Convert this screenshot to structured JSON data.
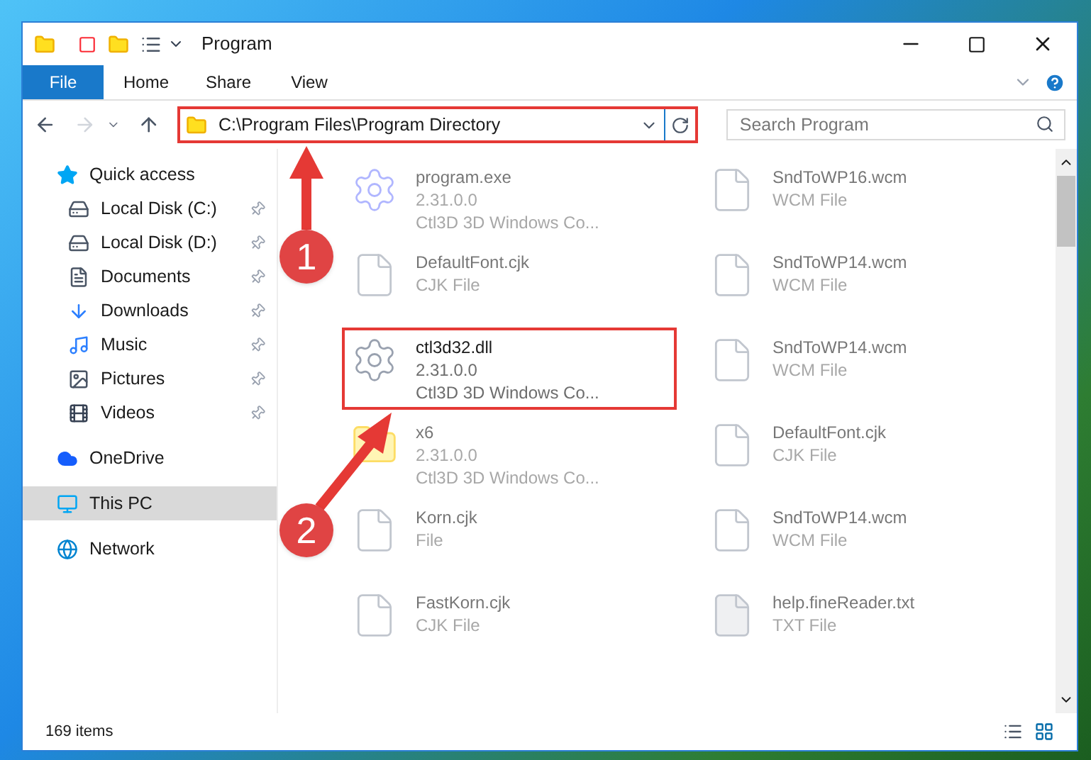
{
  "window": {
    "title": "Program"
  },
  "ribbon_tabs": [
    {
      "label": "File",
      "selected": true
    },
    {
      "label": "Home",
      "selected": false
    },
    {
      "label": "Share",
      "selected": false
    },
    {
      "label": "View",
      "selected": false
    }
  ],
  "address": {
    "path": "C:\\Program Files\\Program Directory",
    "highlighted": true
  },
  "search": {
    "placeholder": "Search Program"
  },
  "sidebar": [
    {
      "label": "Quick access",
      "kind": "star",
      "selected": false,
      "children": [
        {
          "label": "Local Disk (C:)",
          "kind": "drive",
          "pinned": true,
          "selected": false
        },
        {
          "label": "Local Disk (D:)",
          "kind": "drive",
          "pinned": true,
          "selected": false
        },
        {
          "label": "Documents",
          "kind": "document",
          "pinned": true,
          "selected": false
        },
        {
          "label": "Downloads",
          "kind": "download",
          "pinned": true,
          "selected": false
        },
        {
          "label": "Music",
          "kind": "music",
          "pinned": true,
          "selected": false
        },
        {
          "label": "Pictures",
          "kind": "picture",
          "pinned": true,
          "selected": false
        },
        {
          "label": "Videos",
          "kind": "video",
          "pinned": true,
          "selected": false
        }
      ]
    },
    {
      "label": "OneDrive",
      "kind": "cloud",
      "selected": false
    },
    {
      "label": "This PC",
      "kind": "pc",
      "selected": true
    },
    {
      "label": "Network",
      "kind": "network",
      "selected": false
    }
  ],
  "files": [
    {
      "name": "program.exe",
      "lines": [
        "2.31.0.0",
        "Ctl3D 3D Windows Co..."
      ],
      "kind": "exe",
      "highlighted": false
    },
    {
      "name": "SndToWP16.wcm",
      "lines": [
        "WCM File"
      ],
      "kind": "blank",
      "highlighted": false
    },
    {
      "name": "DefaultFont.cjk",
      "lines": [
        "CJK File"
      ],
      "kind": "blank",
      "highlighted": false
    },
    {
      "name": "SndToWP14.wcm",
      "lines": [
        "WCM File"
      ],
      "kind": "blank",
      "highlighted": false
    },
    {
      "name": "ctl3d32.dll",
      "lines": [
        "2.31.0.0",
        "Ctl3D 3D Windows Co..."
      ],
      "kind": "dll",
      "highlighted": true
    },
    {
      "name": "SndToWP14.wcm",
      "lines": [
        "WCM File"
      ],
      "kind": "blank",
      "highlighted": false
    },
    {
      "name": "x6",
      "lines": [
        "2.31.0.0",
        "Ctl3D 3D Windows Co..."
      ],
      "kind": "folder",
      "highlighted": false
    },
    {
      "name": "DefaultFont.cjk",
      "lines": [
        "CJK File"
      ],
      "kind": "blank",
      "highlighted": false
    },
    {
      "name": "Korn.cjk",
      "lines": [
        "File"
      ],
      "kind": "blank",
      "highlighted": false
    },
    {
      "name": "SndToWP14.wcm",
      "lines": [
        "WCM File"
      ],
      "kind": "blank",
      "highlighted": false
    },
    {
      "name": "FastKorn.cjk",
      "lines": [
        "CJK File"
      ],
      "kind": "blank",
      "highlighted": false
    },
    {
      "name": "help.fineReader.txt",
      "lines": [
        "TXT File"
      ],
      "kind": "text",
      "highlighted": false
    }
  ],
  "callouts": [
    "1",
    "2"
  ],
  "status_bar": {
    "count": "169 items"
  }
}
